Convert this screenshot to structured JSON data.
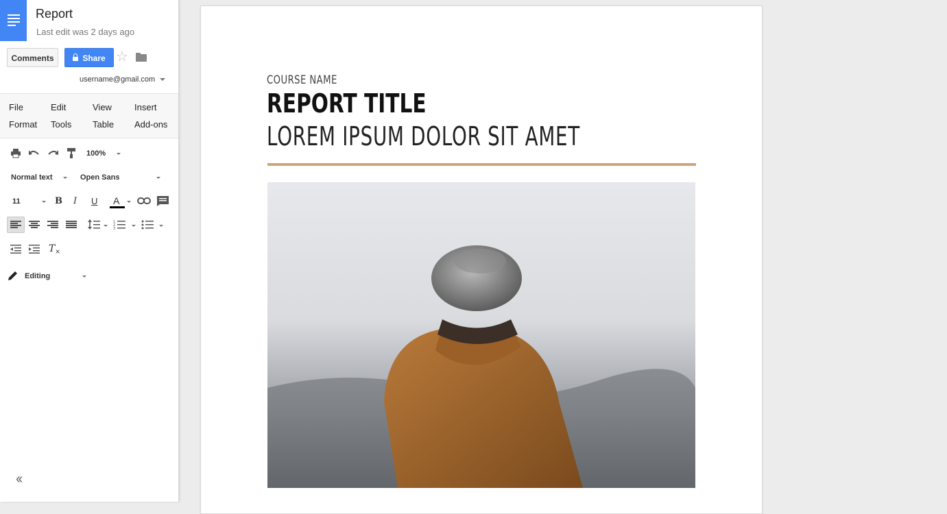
{
  "app": {
    "title": "Report",
    "last_edit": "Last edit was 2 days ago",
    "comments_label": "Comments",
    "share_label": "Share",
    "account": "username@gmail.com",
    "accent_color": "#4285f4"
  },
  "menu": {
    "items": [
      "File",
      "Edit",
      "View",
      "Insert",
      "Format",
      "Tools",
      "Table",
      "Add-ons"
    ]
  },
  "toolbar": {
    "zoom": "100%",
    "style": "Normal text",
    "font": "Open Sans",
    "font_size": "11",
    "mode": "Editing",
    "icons": [
      "print-icon",
      "undo-icon",
      "redo-icon",
      "paint-format-icon",
      "bold-icon",
      "italic-icon",
      "underline-icon",
      "text-color-icon",
      "link-icon",
      "comment-icon",
      "align-left-icon",
      "align-center-icon",
      "align-right-icon",
      "justify-icon",
      "line-spacing-icon",
      "numbered-list-icon",
      "bulleted-list-icon",
      "decrease-indent-icon",
      "increase-indent-icon",
      "clear-formatting-icon",
      "pencil-icon",
      "collapse-icon"
    ]
  },
  "document": {
    "course_name": "COURSE NAME",
    "report_title": "REPORT TITLE",
    "subtitle": "LOREM IPSUM DOLOR SIT AMET",
    "rule_color": "#c9a77a"
  }
}
